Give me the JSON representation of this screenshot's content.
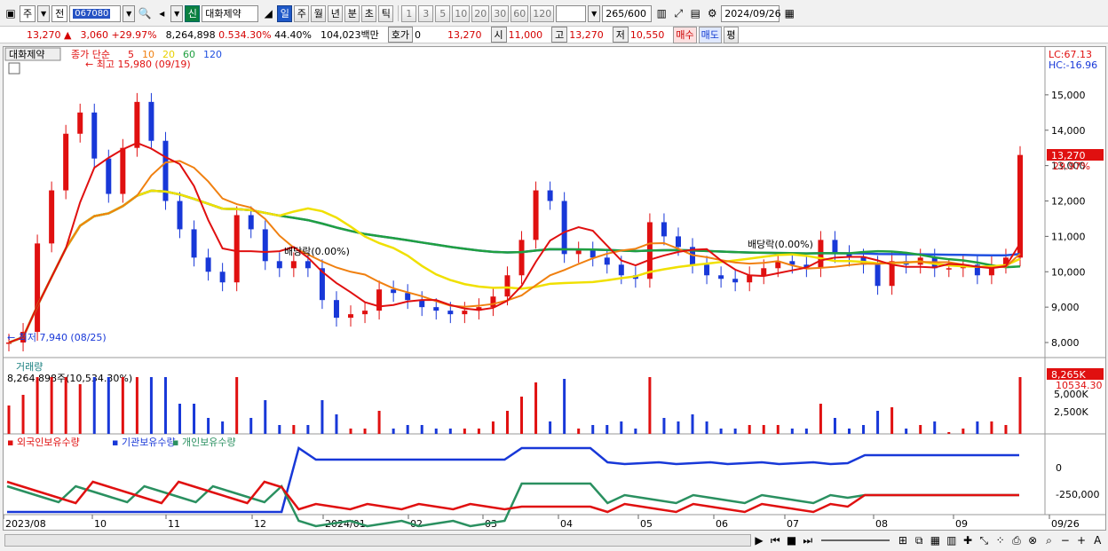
{
  "toolbar": {
    "market": "주",
    "period_prefix": "전",
    "code": "067080",
    "stock_name": "대화제약",
    "credit_badge": "신",
    "periods": [
      "일",
      "주",
      "월",
      "년",
      "분",
      "초",
      "틱"
    ],
    "active_period": "일",
    "minutes": [
      "1",
      "3",
      "5",
      "10",
      "20",
      "30",
      "60",
      "120"
    ],
    "count": "265",
    "count_max": "/600",
    "date": "2024/09/26"
  },
  "quote": {
    "price": "13,270",
    "change": "3,060",
    "change_pct": "+29.97%",
    "volume": "8,264,898",
    "volume_ratio": "0.534.30%",
    "turnover": "44.40%",
    "amount": "104,023백만",
    "hoga_label": "호가",
    "hoga_value": "0",
    "ask": "13,270",
    "open_label": "시",
    "open": "11,000",
    "high_label": "고",
    "high": "13,270",
    "low_label": "저",
    "low": "10,550",
    "buy": "매수",
    "sell": "매도",
    "equal": "평"
  },
  "price_panel": {
    "name_tag": "대화제약",
    "ma_label": "종가 단순",
    "mas": [
      {
        "p": "5",
        "color": "#e01010"
      },
      {
        "p": "10",
        "color": "#f08010"
      },
      {
        "p": "20",
        "color": "#e8d000"
      },
      {
        "p": "60",
        "color": "#20a040"
      },
      {
        "p": "120",
        "color": "#2050e0"
      }
    ],
    "high_note": "최고 15,980 (09/19)",
    "low_note": "최저 7,940 (08/25)",
    "lc": "LC:67.13",
    "hc": "HC:-16.96",
    "last_price": "13,270",
    "last_pct": "29.97%",
    "y_ticks": [
      "15,000",
      "14,000",
      "13,000",
      "12,000",
      "11,000",
      "10,000",
      "9,000",
      "8,000"
    ],
    "dividend_1": "배당락(0.00%)",
    "dividend_2": "배당락(0.00%)"
  },
  "volume_panel": {
    "title": "거래량",
    "info": "8,264,898주(10,534.30%)",
    "last": "8,265K",
    "last_pct": "10534.30",
    "y_ticks": [
      "5,000K",
      "2,500K"
    ]
  },
  "holder_panel": {
    "foreign": "외국인보유수량",
    "inst": "기관보유수량",
    "indiv": "개인보유수량",
    "y_ticks": [
      "0",
      "-250,000"
    ]
  },
  "x_axis": {
    "labels": [
      "2023/08",
      "10",
      "11",
      "12",
      "2024/01",
      "02",
      "03",
      "04",
      "05",
      "06",
      "07",
      "08",
      "09",
      "09/26"
    ]
  },
  "colors": {
    "up": "#e01010",
    "down": "#1838d8",
    "ma5": "#e01010",
    "ma10": "#f08010",
    "ma20": "#f0e000",
    "ma60": "#20a040",
    "ma120": "#2050e0"
  },
  "chart_data": {
    "type": "line",
    "title": "대화제약",
    "series": [
      {
        "name": "종가",
        "values": [
          8.0,
          8.3,
          10.8,
          12.3,
          13.9,
          14.5,
          13.2,
          12.2,
          13.5,
          14.8,
          13.7,
          12.0,
          11.2,
          10.4,
          10.0,
          9.7,
          11.6,
          11.2,
          10.3,
          10.1,
          10.3,
          10.1,
          9.2,
          8.7,
          8.8,
          8.9,
          9.5,
          9.4,
          9.2,
          9.0,
          8.9,
          8.8,
          8.9,
          9.0,
          9.3,
          9.9,
          10.9,
          12.3,
          12.0,
          10.5,
          10.6,
          10.4,
          10.2,
          9.9,
          9.8,
          11.4,
          11.0,
          10.7,
          10.2,
          9.9,
          9.8,
          9.7,
          9.9,
          10.1,
          10.3,
          10.2,
          10.1,
          10.9,
          10.5,
          10.4,
          10.2,
          9.6,
          10.3,
          10.2,
          10.4,
          10.1,
          10.1,
          10.2,
          9.9,
          10.2,
          10.4,
          13.3
        ]
      }
    ]
  }
}
